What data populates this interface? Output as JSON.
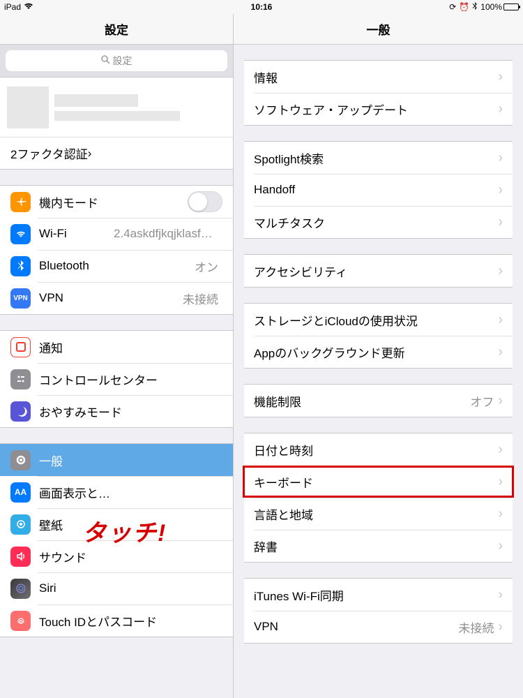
{
  "statusbar": {
    "device": "iPad",
    "wifi_icon": "wifi",
    "time": "10:16",
    "orientation_lock": true,
    "alarm": true,
    "bluetooth": true,
    "battery_percent": "100%"
  },
  "header": {
    "left_title": "設定",
    "right_title": "一般"
  },
  "search": {
    "placeholder": "設定"
  },
  "sidebar": {
    "two_factor": "2ファクタ認証",
    "airplane": "機内モード",
    "wifi": {
      "label": "Wi-Fi",
      "value": "2.4askdfjkqjklasfdlbk..."
    },
    "bluetooth": {
      "label": "Bluetooth",
      "value": "オン"
    },
    "vpn": {
      "label": "VPN",
      "value": "未接続"
    },
    "notifications": "通知",
    "control_center": "コントロールセンター",
    "dnd": "おやすみモード",
    "general": "一般",
    "display": "画面表示と…",
    "wallpaper": "壁紙",
    "sounds": "サウンド",
    "siri": "Siri",
    "touchid": "Touch IDとパスコード"
  },
  "detail": {
    "about": "情報",
    "software_update": "ソフトウェア・アップデート",
    "spotlight": "Spotlight検索",
    "handoff": "Handoff",
    "multitask": "マルチタスク",
    "accessibility": "アクセシビリティ",
    "storage": "ストレージとiCloudの使用状況",
    "background_refresh": "Appのバックグラウンド更新",
    "restrictions": {
      "label": "機能制限",
      "value": "オフ"
    },
    "datetime": "日付と時刻",
    "keyboard": "キーボード",
    "language_region": "言語と地域",
    "dictionary": "辞書",
    "itunes_wifi": "iTunes Wi-Fi同期",
    "vpn": {
      "label": "VPN",
      "value": "未接続"
    }
  },
  "annotation": {
    "text": "タッチ!"
  }
}
